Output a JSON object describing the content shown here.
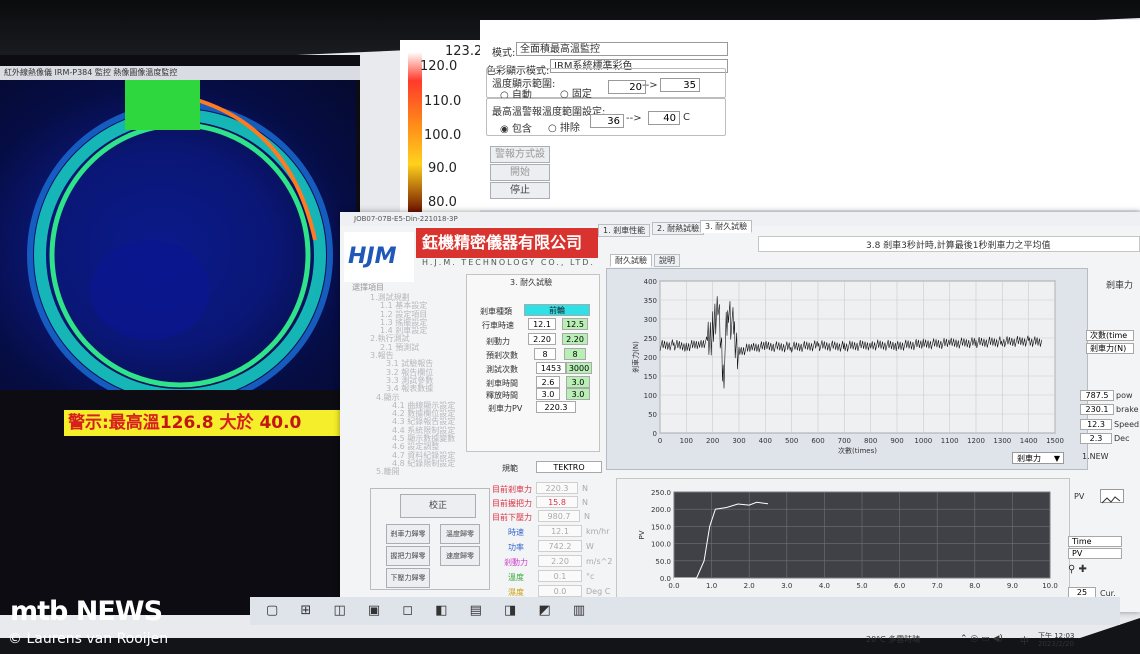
{
  "thermal": {
    "title": "紅外線熱像儀 IRM-P384 監控 熱像圖像溫度監控",
    "alarm_label": "警示:最高溫",
    "alarm_value": "126.8",
    "alarm_mid": "大於",
    "alarm_threshold": "40.0"
  },
  "scale": {
    "max": "123.2",
    "ticks": [
      "120.0",
      "110.0",
      "100.0",
      "90.0",
      "80.0"
    ]
  },
  "settings": {
    "mode_label": "模式:",
    "mode_value": "全面積最高溫監控",
    "color_label": "色彩顯示模式:",
    "color_value": "IRM系統標準彩色",
    "range_group": "溫度顯示範圍:",
    "range_auto": "自動",
    "range_fixed": "固定",
    "range_min": "20",
    "range_arrow": "-->",
    "range_max": "35",
    "alarm_group": "最高溫警報溫度範圍設定:",
    "alarm_include": "包含",
    "alarm_exclude": "排除",
    "alarm_min": "36",
    "alarm_arrow": "-->",
    "alarm_max": "40",
    "alarm_unit": "C",
    "btn_alarm_setting": "警報方式設定",
    "btn_start": "開始",
    "btn_stop": "停止"
  },
  "app": {
    "title": "JOB07-07B-E5-Din-221018-3P",
    "logo": "HJM",
    "company_cn": "鈺機精密儀器有限公司",
    "company_en": "H.J.M. TECHNOLOGY CO., LTD.",
    "menu_header": "選擇項目",
    "menu_items": [
      "1.測試規劃",
      "1.1 基本設定",
      "1.2 設定項目",
      "1.3 搖擺設定",
      "1.4 剎車設定",
      "2.執行測試",
      "2.1 預測試",
      "3.報告",
      "3.1 試驗報告",
      "3.2 報告欄位",
      "3.3 測試參數",
      "3.4 報表數據",
      "4.顯示",
      "4.1 曲線顯示設定",
      "4.2 數據欄位設定",
      "4.3 紀錄報告設定",
      "4.4 系統限制設定",
      "4.5 顯示數據變數",
      "4.6 設定調整",
      "4.7 資料紀錄設定",
      "4.8 紀錄限制設定",
      "5.離開"
    ],
    "section_title": "3. 耐久試驗",
    "fields": [
      {
        "label": "剎車種類",
        "value": "前輪",
        "style": "cyan"
      },
      {
        "label": "行車時速",
        "value": "12.1",
        "set": "12.5"
      },
      {
        "label": "剎動力",
        "value": "2.20",
        "set": "2.20"
      },
      {
        "label": "預剎次數",
        "value": "8",
        "set": "8"
      },
      {
        "label": "測試次數",
        "value": "1453",
        "set": "3000"
      },
      {
        "label": "剎車時間",
        "value": "2.6",
        "set": "3.0"
      },
      {
        "label": "釋放時間",
        "value": "3.0",
        "set": "3.0"
      }
    ],
    "brake_pv_label": "剎車力PV",
    "brake_pv_value": "220.3",
    "spec_label": "規範",
    "spec_value": "TEKTRO",
    "readouts": [
      {
        "label": "目前剎車力",
        "value": "220.3",
        "unit": "N"
      },
      {
        "label": "目前握把力",
        "value": "15.8",
        "unit": "N"
      },
      {
        "label": "目前下壓力",
        "value": "980.7",
        "unit": "N"
      },
      {
        "label": "時速",
        "value": "12.1",
        "unit": "km/hr"
      },
      {
        "label": "功率",
        "value": "742.2",
        "unit": "W"
      },
      {
        "label": "剎動力",
        "value": "2.20",
        "unit": "m/s^2"
      },
      {
        "label": "溫度",
        "value": "0.1",
        "unit": "°c"
      },
      {
        "label": "濕度",
        "value": "0.0",
        "unit": "Deg C"
      }
    ],
    "btn_reset": "校正",
    "btn_grid": [
      "剎車力歸零",
      "溫度歸零",
      "握把力歸零",
      "速度歸零",
      "下壓力歸零"
    ],
    "tabs": [
      "1. 剎車性能",
      "2. 耐熱試驗",
      "3. 耐久試驗"
    ],
    "sub_tabs": [
      "耐久試驗",
      "說明"
    ],
    "chart_caption": "3.8 剎車3秒計時,計算最後1秒剎車力之平均值",
    "channel_select": "剎車力",
    "right_label": "剎車力",
    "right_items": [
      {
        "value": "次數(time",
        "label": ""
      },
      {
        "value": "剎車力(N)",
        "label": ""
      },
      {
        "value": "787.5",
        "label": "pow"
      },
      {
        "value": "230.1",
        "label": "brake"
      },
      {
        "value": "12.3",
        "label": "Speed"
      },
      {
        "value": "2.3",
        "label": "Dec"
      },
      {
        "value": "1.NEW",
        "label": ""
      }
    ],
    "pv_label": "PV",
    "time_label": "Time",
    "pv_label2": "PV",
    "cur_label": "Cur.",
    "cur_value": "25"
  },
  "taskbar": {
    "weather": "20°C 多雲時晴",
    "ime": "中",
    "time": "下午 12:03",
    "date": "2023/2/20"
  },
  "watermark": {
    "brand": "mtb NEWS",
    "credit": "© Laurens van Rooijen"
  },
  "chart_data": [
    {
      "type": "line",
      "title": "",
      "xlabel": "次數(times)",
      "ylabel": "剎車力(N)",
      "xlim": [
        0,
        1500
      ],
      "ylim": [
        0,
        400
      ],
      "x_ticks": [
        0,
        100,
        200,
        300,
        400,
        500,
        600,
        700,
        800,
        900,
        1000,
        1100,
        1200,
        1300,
        1400,
        1500
      ],
      "y_ticks": [
        0,
        50,
        100,
        150,
        200,
        250,
        300,
        350,
        400
      ],
      "grid": true,
      "series": [
        {
          "x": [
            0,
            50,
            100,
            150,
            180,
            200,
            220,
            240,
            260,
            280,
            300,
            350,
            400,
            500,
            600,
            700,
            800,
            900,
            1000,
            1100,
            1200,
            1300,
            1400,
            1453
          ],
          "y": [
            230,
            232,
            228,
            234,
            240,
            260,
            330,
            150,
            340,
            260,
            215,
            225,
            228,
            226,
            230,
            228,
            232,
            230,
            234,
            236,
            238,
            240,
            242,
            238
          ]
        }
      ]
    },
    {
      "type": "line",
      "title": "",
      "xlabel": "",
      "ylabel": "PV",
      "xlim": [
        0,
        10
      ],
      "ylim": [
        0,
        250
      ],
      "x_ticks": [
        0.0,
        1.0,
        2.0,
        3.0,
        4.0,
        5.0,
        6.0,
        7.0,
        8.0,
        9.0,
        10.0
      ],
      "y_ticks": [
        0.0,
        50.0,
        100.0,
        150.0,
        200.0,
        250.0
      ],
      "grid": true,
      "series": [
        {
          "x": [
            0,
            0.6,
            0.8,
            0.95,
            1.1,
            1.4,
            1.7,
            2.0,
            2.2,
            2.5
          ],
          "y": [
            0,
            0,
            50,
            150,
            200,
            205,
            215,
            212,
            220,
            216
          ]
        }
      ]
    }
  ]
}
